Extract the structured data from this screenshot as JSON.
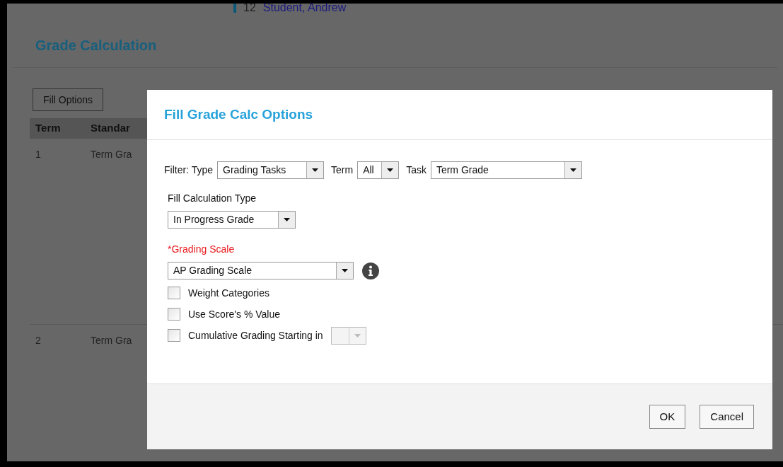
{
  "background": {
    "student": {
      "number": "12",
      "name": "Student, Andrew"
    },
    "title": "Grade Calculation",
    "fill_button": "Fill Options",
    "table": {
      "columns": [
        "Term",
        "Standar"
      ],
      "rows": [
        [
          "1",
          "Term Gra"
        ],
        [
          "2",
          "Term Gra"
        ]
      ]
    }
  },
  "dialog": {
    "title": "Fill Grade Calc Options",
    "filters": [
      {
        "label": "Filter: Type",
        "value": "Grading Tasks"
      },
      {
        "label": "Term",
        "value": "All"
      },
      {
        "label": "Task",
        "value": "Term Grade"
      }
    ],
    "fill_calc_type": {
      "label": "Fill Calculation Type",
      "value": "In Progress Grade"
    },
    "grading_scale": {
      "label": "*Grading Scale",
      "required": true,
      "value": "AP Grading Scale"
    },
    "options": [
      {
        "kind": "checkbox",
        "label": "Weight Categories",
        "checked": false
      },
      {
        "kind": "checkbox",
        "label": "Use Score's % Value",
        "checked": false
      },
      {
        "kind": "checkbox-select",
        "label": "Cumulative Grading Starting in",
        "checked": false,
        "disabled": true
      }
    ],
    "buttons": [
      "OK",
      "Cancel"
    ]
  }
}
